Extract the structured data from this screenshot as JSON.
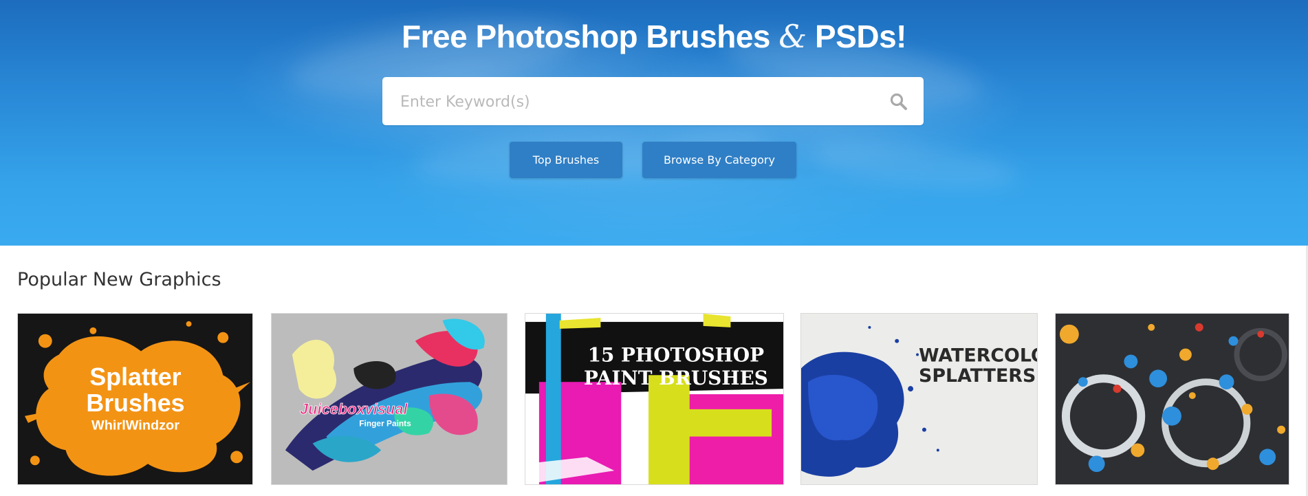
{
  "hero": {
    "title_part1": "Free Photoshop Brushes",
    "title_amp": "&",
    "title_part2": "PSDs!",
    "search": {
      "placeholder": "Enter Keyword(s)",
      "value": "",
      "icon": "search-icon"
    },
    "buttons": {
      "top_brushes": "Top Brushes",
      "browse_by_category": "Browse By Category"
    }
  },
  "popular": {
    "heading": "Popular New Graphics",
    "items": [
      {
        "line1": "Splatter",
        "line2": "Brushes",
        "line3": "WhirlWindzor"
      },
      {
        "line1": "Juiceboxvisual",
        "line2": "Finger Paints"
      },
      {
        "line1": "15 PHOTOSHOP",
        "line2": "PAINT BRUSHES"
      },
      {
        "line1": "WATERCOLOR",
        "line2": "SPLATTERS"
      },
      {
        "line1": ""
      }
    ]
  },
  "colors": {
    "hero_top": "#1d6cbd",
    "hero_bottom": "#3aaaf0",
    "button_bg": "#2f7fc6",
    "heading_text": "#333333"
  }
}
